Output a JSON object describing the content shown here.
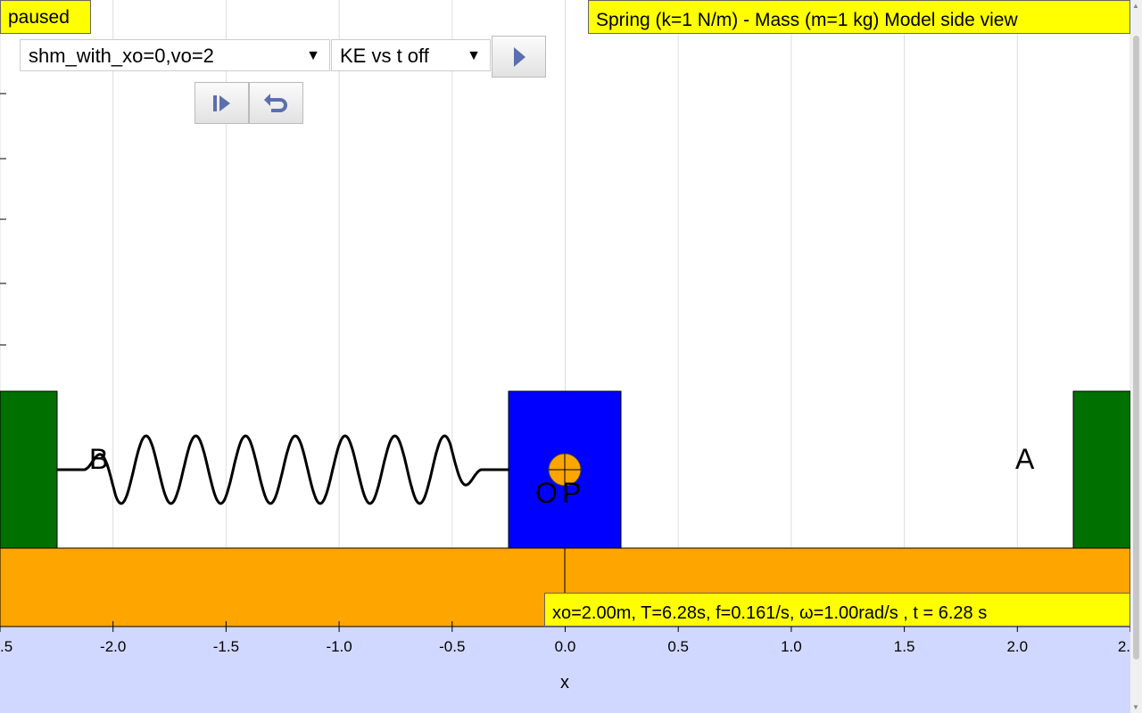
{
  "status": "paused",
  "title": "Spring (k=1 N/m) - Mass (m=1 kg) Model side view",
  "info": "xo=2.00m, T=6.28s, f=0.161/s, ω=1.00rad/s , t = 6.28 s",
  "model_select": {
    "value": "shm_with_xo=0,vo=2"
  },
  "graph_select": {
    "value": "KE vs t off"
  },
  "controls": {
    "play_icon": "play-icon",
    "step_icon": "step-forward-icon",
    "reset_icon": "reset-icon"
  },
  "labels": {
    "B": "B",
    "A": "A",
    "O": "O",
    "P": "P"
  },
  "axis": {
    "xlabel": "x",
    "ticks": [
      {
        "value": -2.5,
        "label": ".5"
      },
      {
        "value": -2.0,
        "label": "-2.0"
      },
      {
        "value": -1.5,
        "label": "-1.5"
      },
      {
        "value": -1.0,
        "label": "-1.0"
      },
      {
        "value": -0.5,
        "label": "-0.5"
      },
      {
        "value": 0.0,
        "label": "0.0"
      },
      {
        "value": 0.5,
        "label": "0.5"
      },
      {
        "value": 1.0,
        "label": "1.0"
      },
      {
        "value": 1.5,
        "label": "1.5"
      },
      {
        "value": 2.0,
        "label": "2.0"
      },
      {
        "value": 2.5,
        "label": "2."
      }
    ]
  },
  "sim": {
    "xmin": -2.5,
    "xmax": 2.5,
    "mass_x": 0.0,
    "mass_width": 0.5,
    "wall_left_x": -2.25,
    "wall_right_x": 2.25
  },
  "colors": {
    "wall": "#007000",
    "mass": "#0000ff",
    "floor": "#ffa500",
    "ball": "#ffa500",
    "axis_bg": "#d0d8ff",
    "label_bg": "#ffff00",
    "grid": "#dddddd"
  }
}
